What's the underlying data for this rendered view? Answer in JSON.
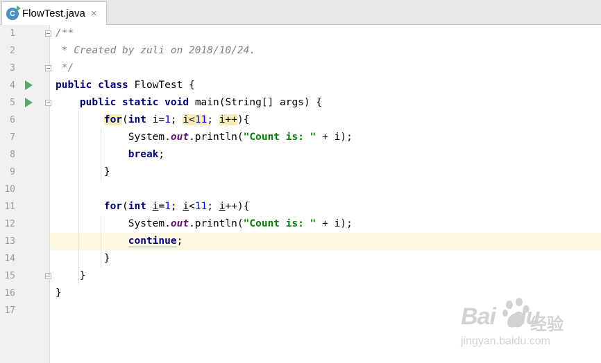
{
  "tab": {
    "filename": "FlowTest.java",
    "icon": "java-class-icon",
    "close": "×"
  },
  "line_numbers": [
    "1",
    "2",
    "3",
    "4",
    "5",
    "6",
    "7",
    "8",
    "9",
    "10",
    "11",
    "12",
    "13",
    "14",
    "15",
    "16",
    "17"
  ],
  "current_line": 13,
  "code": {
    "l1": "/**",
    "l2": " * Created by zuli on 2018/10/24.",
    "l3": " */",
    "kw_public": "public",
    "kw_class": "class",
    "class_name": " FlowTest {",
    "kw_static": "static",
    "kw_void": "void",
    "main_sig": " main(String[] args) {",
    "kw_for": "for",
    "kw_int": "int",
    "var_i": "i",
    "one": "1",
    "eleven": "11",
    "system": "System.",
    "out": "out",
    "println": ".println(",
    "str_count": "\"Count is: \"",
    "plus_i": " + i);",
    "kw_break": "break",
    "kw_continue": "continue",
    "close_brace": "}"
  },
  "colors": {
    "keyword": "#000080",
    "string": "#008000",
    "number": "#0000ff",
    "comment": "#808080",
    "field": "#660e7a",
    "current_line_bg": "#fdf8e2",
    "run_icon": "#59a869"
  },
  "watermark": {
    "brand": "Bai",
    "brand_suffix": "du",
    "chinese": "经验",
    "url": "jingyan.baidu.com"
  }
}
